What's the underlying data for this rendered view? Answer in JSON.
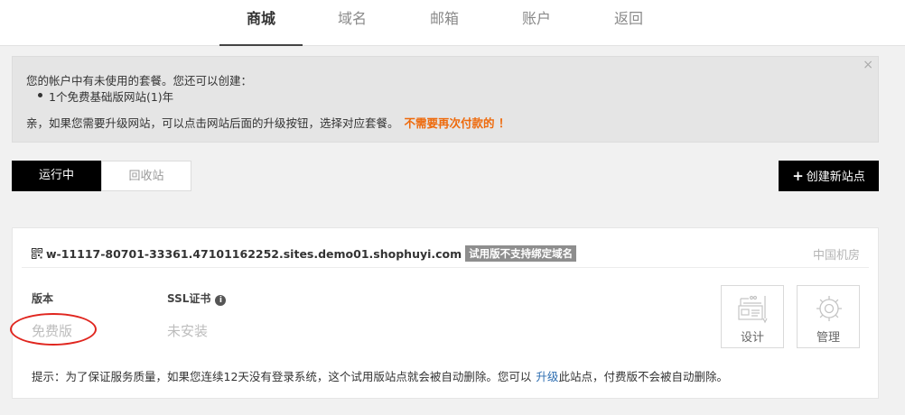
{
  "nav": {
    "tabs": [
      "商城",
      "域名",
      "邮箱",
      "账户",
      "返回"
    ]
  },
  "notice": {
    "line1": "您的帐户中有未使用的套餐。您还可以创建：",
    "bullet": "1个免费基础版网站(1)年",
    "line3": "亲，如果您需要升级网站，可以点击网站后面的升级按钮，选择对应套餐。",
    "highlight": "不需要再次付款的 ！",
    "close": "×"
  },
  "toolbar": {
    "running": "运行中",
    "recycle": "回收站",
    "create": "创建新站点",
    "create_icon": "+"
  },
  "site": {
    "hostname": "w-11117-80701-33361.47101162252.sites.demo01.shophuyi.com",
    "badge": "试用版不支持绑定域名",
    "region": "中国机房",
    "version_label": "版本",
    "version_value": "免费版",
    "ssl_label": "SSL证书",
    "ssl_info_icon": "i",
    "ssl_value": "未安装",
    "design": "设计",
    "manage": "管理",
    "tip_text": "提示：为了保证服务质量，如果您连续12天没有登录系统，这个试用版站点就会被自动删除。您可以",
    "upgrade": "升级",
    "tip_end": "此站点，付费版不会被自动删除。"
  },
  "colors": {
    "accent": "#ee6a0c",
    "link": "#2b6cb0",
    "annotation": "#e0261f"
  }
}
